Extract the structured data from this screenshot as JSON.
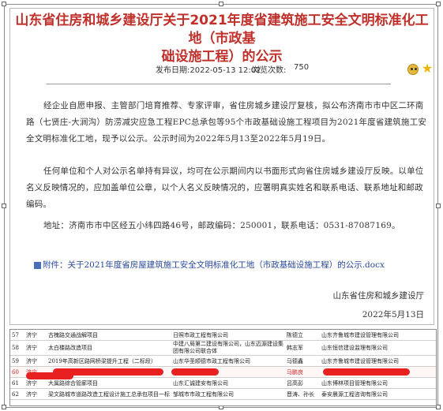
{
  "notice": {
    "title_line1": "山东省住房和城乡建设厅关于2021年度省建筑施工安全文明标准化工地（市政基",
    "title_line2": "础设施工程）的公示",
    "publish_time_label": "发布日期:2022-05-13 12:02",
    "views_label": "浏览次数:",
    "views_value": "750",
    "paragraphs": [
      "经企业自愿申报、主管部门培育推荐、专家评审，省住房城乡建设厅复核，拟公布济南市市中区二环南路（七贤庄-大涧沟）防涝减灾应急工程EPC总承包等95个市政基础设施工程项目为2021年度省建筑施工安全文明标准化工地，现予以公示。公示时间为2022年5月13至2022年5月19日。",
      "任何单位和个人对公示名单持有异议，均可在公示期间内以书面形式向省住房城乡建设厅反映。以单位名义反映情况的，应加盖单位公章，以个人名义反映情况的，应署明真实姓名和联系电话、联系地址和邮政编码。",
      "地址：济南市市中区经五小纬四路46号，邮政编码：250001，联系电话：0531-87087169。"
    ],
    "attachment": "附件：关于2021年度省房屋建筑施工安全文明标准化工地（市政基础设施工程）的公示.docx",
    "signature": "山东省住房和城乡建设厅",
    "date": "2022年5月13日"
  },
  "table": {
    "rows": [
      {
        "no": "57",
        "city": "济宁",
        "project": "古槐路交通战解项目",
        "contractor": "日照市政工程有限公司",
        "manager": "陈德立",
        "supervisor": "山东齐鲁城市建设管理有限公司"
      },
      {
        "no": "58",
        "city": "济宁",
        "project": "太白楼路改造项目",
        "contractor": "中建八局第二建设有限公司，山东迈源建设集团有限公司联合体",
        "manager": "韩志军",
        "supervisor": "山东恒信建设监理有限公司"
      },
      {
        "no": "59",
        "city": "济宁",
        "project": "2019年高新区路网桥梁提升工程（二标段）",
        "contractor": "山东华圣顺德市政工程有限公司",
        "manager": "马德鑫",
        "supervisor": "山东齐鲁城市建设管理有限公司"
      },
      {
        "no": "60",
        "city": "济宁",
        "project": "",
        "contractor": "",
        "manager": "马鹏良",
        "supervisor": ""
      },
      {
        "no": "61",
        "city": "济宁",
        "project": "大属路综合管廊项目",
        "contractor": "山东汇诚建安有限公司",
        "manager": "吕高彭",
        "supervisor": "山东博林项目管理有限公司"
      },
      {
        "no": "62",
        "city": "济宁",
        "project": "梁文路城市道路改造工程设计施工总承包项目一标",
        "contractor": "邹城市市政工程有限公司",
        "manager": "晋涛、孙长",
        "supervisor": "泰安晨源工程咨询有限公司"
      }
    ]
  },
  "colors": {
    "title": "#c0312b",
    "redaction": "#e82020",
    "attachment": "#2a4a9c"
  }
}
